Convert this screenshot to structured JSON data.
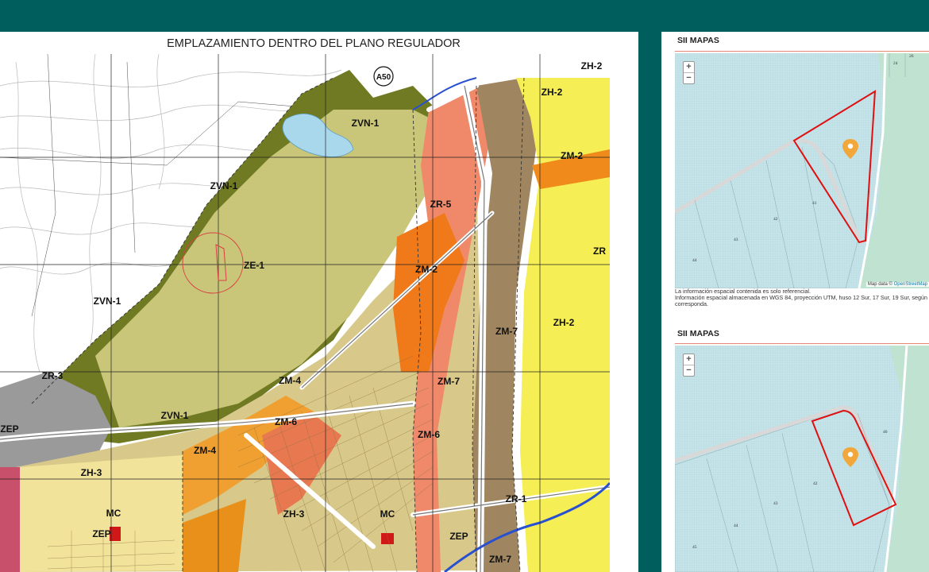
{
  "plan": {
    "title": "EMPLAZAMIENTO DENTRO DEL PLANO REGULADOR",
    "road_label": "A50",
    "zone_labels": [
      "ZH-2",
      "ZH-2",
      "ZM-2",
      "ZR-5",
      "ZM-2",
      "ZVN-1",
      "ZVN-1",
      "ZE-1",
      "ZVN-1",
      "ZR-3",
      "ZM-4",
      "ZM-6",
      "ZVN-1",
      "ZEP",
      "ZM-4",
      "ZH-3",
      "MC",
      "ZEP",
      "ZH-3",
      "MC",
      "ZM-7",
      "ZM-7",
      "ZM-6",
      "ZH-2",
      "ZR-1",
      "ZEP",
      "ZM-7",
      "ZR"
    ]
  },
  "sii": {
    "header_1": "SII MAPAS",
    "header_2": "SII MAPAS",
    "zoom_in": "+",
    "zoom_out": "−",
    "attribution_text": "Map data © ",
    "attribution_link": "OpenStreetMap",
    "notes": [
      "La información espacial contenida es solo referencial.",
      "Información espacial almacenada en WGS 84, proyección UTM, huso 12 Sur, 17 Sur, 19 Sur, según",
      "corresponda."
    ],
    "map1_lots": [
      "41",
      "42",
      "43",
      "44",
      "24",
      "26"
    ],
    "map2_lots": [
      "40",
      "42",
      "43",
      "44",
      "45"
    ],
    "colors": {
      "parcel_outline": "#e01010",
      "marker": "#f2a73b",
      "water": "#c7e6ec",
      "land": "#bfe3d0"
    }
  }
}
